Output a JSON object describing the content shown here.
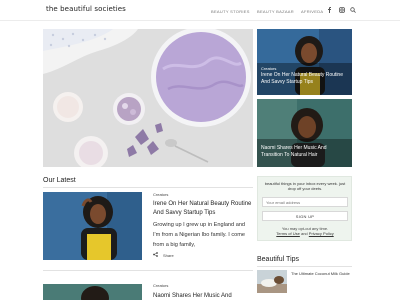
{
  "header": {
    "brand": "the beautiful societies",
    "nav": [
      "BEAUTY STORIES",
      "BEAUTY BAZAAR",
      "AFRIVEDA"
    ]
  },
  "featured": [
    {
      "category": "Creators",
      "title": "Irene On Her Natural Beauty Routine And Savvy Startup Tips"
    },
    {
      "category": "Creators",
      "title": "Naomi Shares Her Music And Transition To Natural Hair"
    }
  ],
  "latest": {
    "heading": "Our Latest",
    "articles": [
      {
        "category": "Creators",
        "title": "Irene On Her Natural Beauty Routine And Savvy Startup Tips",
        "excerpt": "Growing up I grew up in England and I'm from a Nigerian Ibo family. I come from a big family,",
        "share_label": "Share"
      },
      {
        "category": "Creators",
        "title": "Naomi Shares Her Music And Transition"
      }
    ]
  },
  "newsletter": {
    "text": "beautiful things in your inbox every week. just drop off your deets.",
    "email_placeholder": "Your email address",
    "button_label": "SIGN UP",
    "note_prefix": "You may opt-out any time.",
    "terms_link": "Terms of Use",
    "and_text": "and",
    "privacy_link": "Privacy Policy"
  },
  "tips": {
    "heading": "Beautiful Tips",
    "items": [
      {
        "title": "The Ultimate Coconut Milk Guide"
      }
    ]
  }
}
